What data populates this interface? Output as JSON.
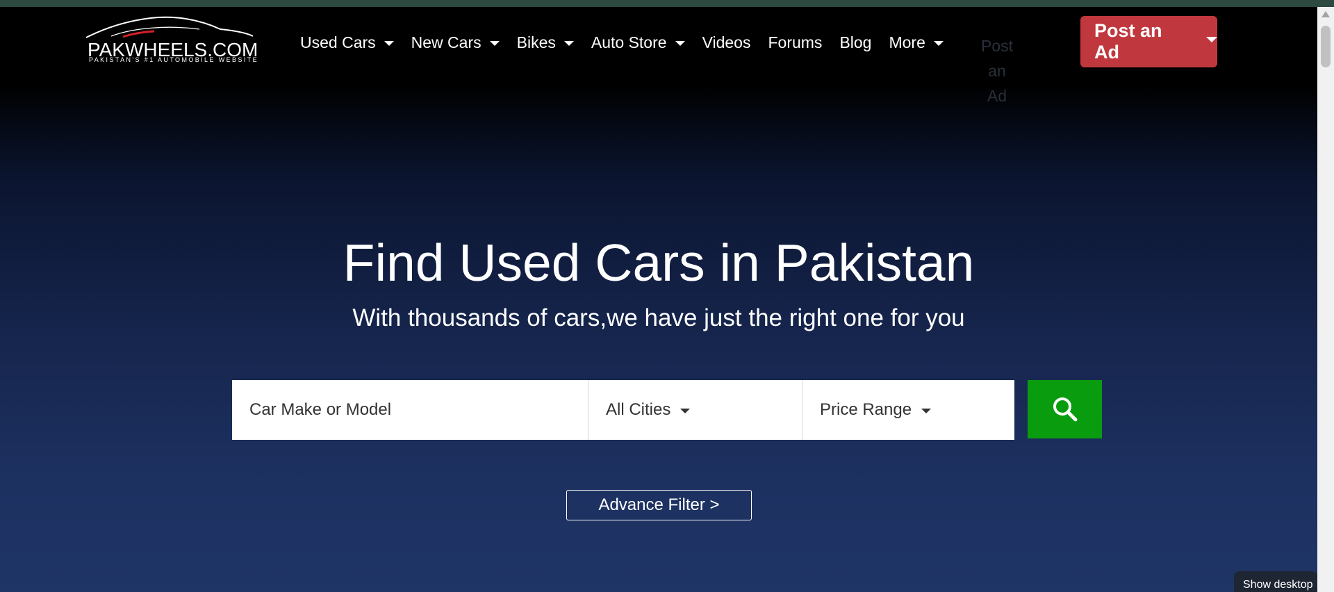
{
  "brand": {
    "name": "PAKWHEELS.COM",
    "tagline": "PAKISTAN'S #1 AUTOMOBILE WEBSITE",
    "icon": "car-silhouette-logo"
  },
  "nav": {
    "items": [
      {
        "label": "Used Cars",
        "has_dropdown": true
      },
      {
        "label": "New Cars",
        "has_dropdown": true
      },
      {
        "label": "Bikes",
        "has_dropdown": true
      },
      {
        "label": "Auto Store",
        "has_dropdown": true
      },
      {
        "label": "Videos",
        "has_dropdown": false
      },
      {
        "label": "Forums",
        "has_dropdown": false
      },
      {
        "label": "Blog",
        "has_dropdown": false
      },
      {
        "label": "More",
        "has_dropdown": true
      }
    ],
    "ghost_post_ad": "Post an Ad"
  },
  "post_ad_button": {
    "label": "Post an Ad",
    "color": "#c0383d"
  },
  "hero": {
    "title": "Find Used Cars in Pakistan",
    "subtitle": "With thousands of cars,we have just the right one for you"
  },
  "search": {
    "placeholder": "Car Make or Model",
    "city_select": "All Cities",
    "price_select": "Price Range",
    "button_icon": "search-icon",
    "button_color": "#099c0f"
  },
  "advance_filter": {
    "label": "Advance Filter >"
  },
  "taskbar_tooltip": {
    "label": "Show desktop"
  }
}
